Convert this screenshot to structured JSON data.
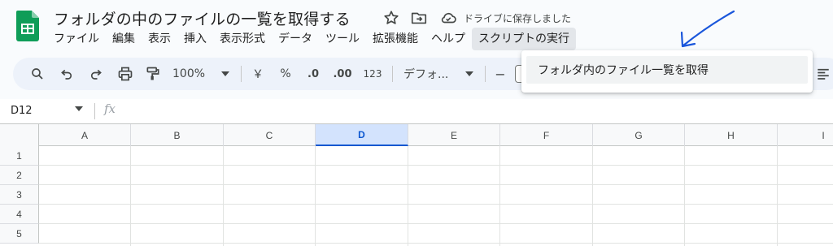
{
  "app": {
    "document_title": "フォルダの中のファイルの一覧を取得する",
    "save_status": "ドライブに保存しました",
    "brand_color": "#0f9d58",
    "title_icons": [
      "star-icon",
      "move-to-folder-icon",
      "cloud-saved-icon"
    ]
  },
  "menubar": {
    "items": [
      "ファイル",
      "編集",
      "表示",
      "挿入",
      "表示形式",
      "データ",
      "ツール",
      "拡張機能",
      "ヘルプ",
      "スクリプトの実行"
    ],
    "active_index": 9
  },
  "dropdown": {
    "items": [
      "フォルダ内のファイル一覧を取得"
    ]
  },
  "toolbar": {
    "zoom": "100%",
    "currency_symbol": "￥",
    "percent_symbol": "%",
    "decrease_decimal": ".0",
    "increase_decimal": ".00",
    "more_formats": "123",
    "font": "デフォ...",
    "minus": "−"
  },
  "formula_bar": {
    "cell_reference": "D12",
    "fx_label": "fx",
    "content": ""
  },
  "grid": {
    "columns": [
      "A",
      "B",
      "C",
      "D",
      "E",
      "F",
      "G",
      "H",
      "I"
    ],
    "selected_column": "D",
    "rows": [
      "1",
      "2",
      "3",
      "4",
      "5"
    ],
    "accent_color": "#0b57d0"
  }
}
